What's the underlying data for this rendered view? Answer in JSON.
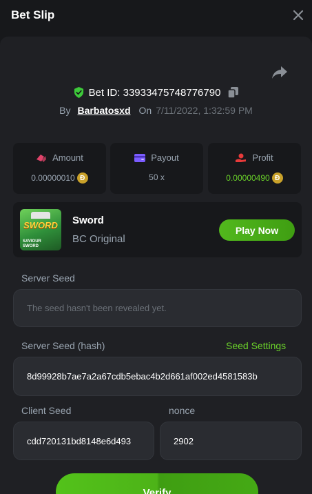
{
  "header": {
    "title": "Bet Slip"
  },
  "bet": {
    "id_label": "Bet ID: 33933475748776790",
    "by_label": "By",
    "username": "Barbatosxd",
    "on_label": "On",
    "date": "7/11/2022, 1:32:59 PM"
  },
  "stats": {
    "amount": {
      "label": "Amount",
      "value": "0.00000010"
    },
    "payout": {
      "label": "Payout",
      "value": "50 x"
    },
    "profit": {
      "label": "Profit",
      "value": "0.00000490"
    }
  },
  "coin_symbol": "Ð",
  "game": {
    "name": "Sword",
    "subtitle": "BC Original",
    "play_label": "Play Now",
    "thumb_title": "SWORD",
    "thumb_subtitle_1": "SAVIOUR",
    "thumb_subtitle_2": "SWORD"
  },
  "server_seed": {
    "label": "Server Seed",
    "placeholder": "The seed hasn't been revealed yet."
  },
  "server_seed_hash": {
    "label": "Server Seed (hash)",
    "settings_label": "Seed Settings",
    "value": "8d99928b7ae7a2a67cdb5ebac4b2d661af002ed4581583b"
  },
  "client_seed": {
    "label": "Client Seed",
    "value": "cdd720131bd8148e6d493"
  },
  "nonce": {
    "label": "nonce",
    "value": "2902"
  },
  "verify": {
    "label": "Verify"
  },
  "colors": {
    "accent_green": "#6bd32a",
    "amount_icon": "#e0436a",
    "payout_icon": "#7b5cff",
    "profit_icon": "#e83a3a",
    "shield": "#3dc93a",
    "coin": "#c9a12a"
  },
  "icons": [
    "close-icon",
    "share-icon",
    "shield-check-icon",
    "copy-icon",
    "amount-icon",
    "wallet-icon",
    "profit-hand-icon",
    "coin-icon"
  ]
}
